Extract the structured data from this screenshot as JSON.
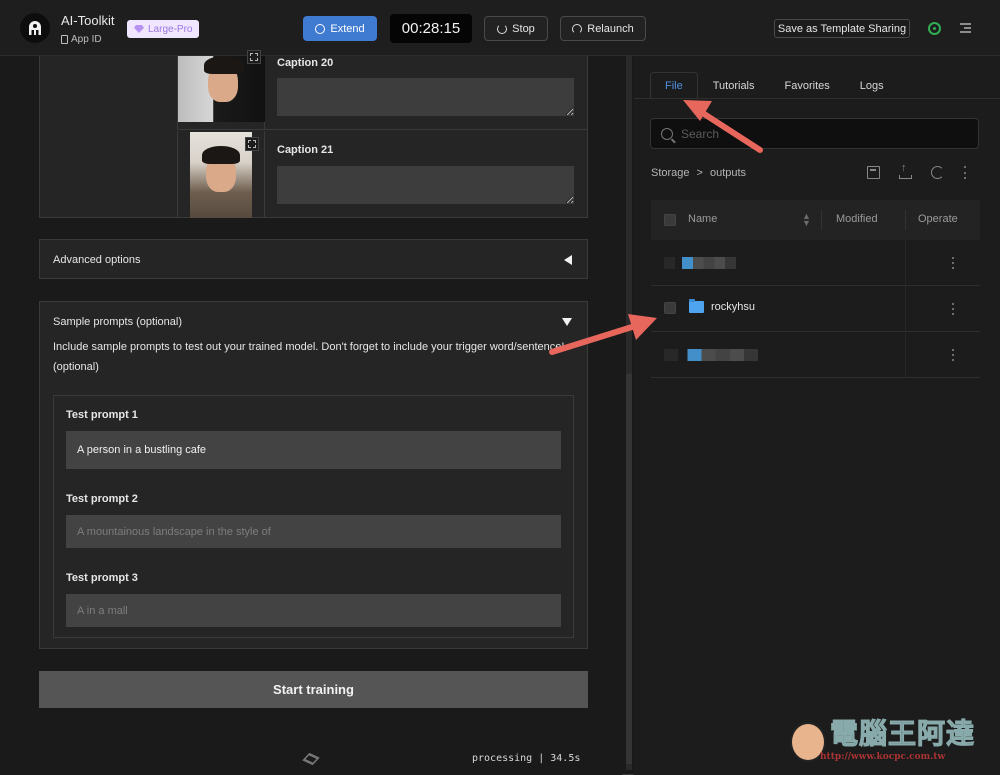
{
  "header": {
    "app_title": "AI-Toolkit",
    "app_id_label": "App ID",
    "plan_badge": "Large-Pro",
    "extend_label": "Extend",
    "timer": "00:28:15",
    "stop_label": "Stop",
    "relaunch_label": "Relaunch",
    "save_template_label": "Save as Template Sharing"
  },
  "captions": [
    {
      "label": "Caption 20",
      "value": ""
    },
    {
      "label": "Caption 21",
      "value": ""
    }
  ],
  "advanced": {
    "title": "Advanced options",
    "expanded": false
  },
  "sample_prompts": {
    "title": "Sample prompts (optional)",
    "expanded": true,
    "description": "Include sample prompts to test out your trained model. Don't forget to include your trigger word/sentence! (optional)",
    "prompts": [
      {
        "label": "Test prompt 1",
        "value": "A person in a bustling cafe",
        "placeholder": ""
      },
      {
        "label": "Test prompt 2",
        "value": "",
        "placeholder": "A mountainous landscape in the style of"
      },
      {
        "label": "Test prompt 3",
        "value": "",
        "placeholder": "A  in a mall"
      }
    ]
  },
  "start_training_label": "Start training",
  "status_text": "processing | 34.5s",
  "file_panel": {
    "tabs": [
      {
        "label": "File",
        "active": true
      },
      {
        "label": "Tutorials",
        "active": false
      },
      {
        "label": "Favorites",
        "active": false
      },
      {
        "label": "Logs",
        "active": false
      }
    ],
    "search_placeholder": "Search",
    "breadcrumb": [
      "Storage",
      ">",
      "outputs"
    ],
    "columns": [
      "Name",
      "Modified",
      "Operate"
    ],
    "rows": [
      {
        "name": "",
        "blurred": true,
        "type": "file"
      },
      {
        "name": "rockyhsu",
        "blurred": false,
        "type": "folder"
      },
      {
        "name": "",
        "blurred": true,
        "type": "file"
      }
    ]
  },
  "watermark": {
    "title": "電腦王阿達",
    "url": "http://www.kocpc.com.tw"
  },
  "colors": {
    "accent": "#3e7bd1",
    "active_tab": "#4f8fe0",
    "annotation_arrow": "#e8675c",
    "folder": "#4ea4ee",
    "whatsapp": "#2fae52"
  }
}
